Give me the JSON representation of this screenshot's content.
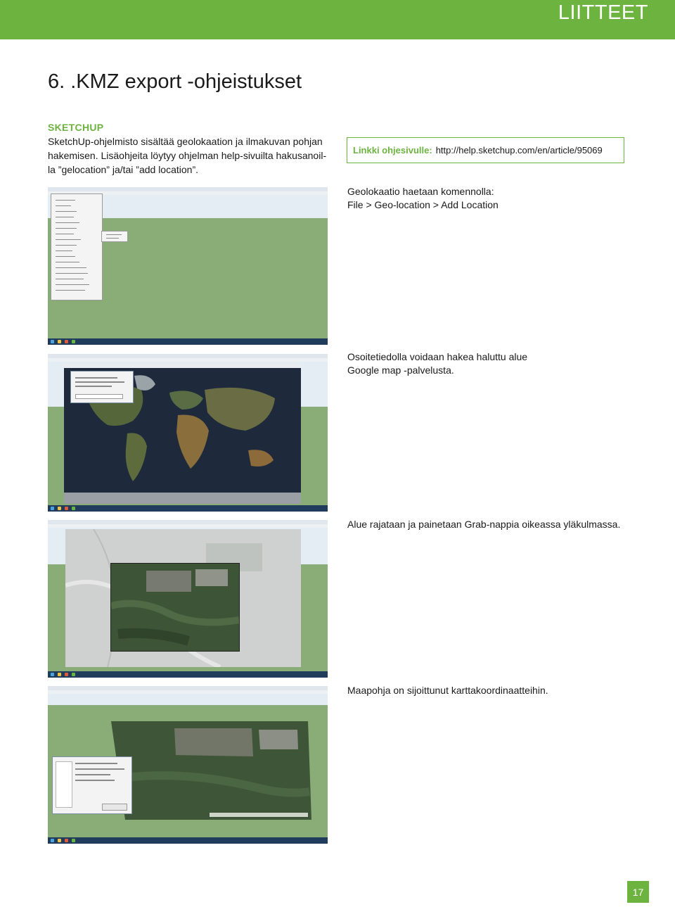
{
  "header": {
    "section_label": "LIITTEET"
  },
  "page": {
    "title": "6. .KMZ export -ohjeistukset",
    "section_heading": "SKETCHUP",
    "intro_lines": [
      "SketchUp-ohjelmisto sisältää geolokaation ja ilmakuvan pohjan",
      "hakemisen. Lisäohjeita löytyy ohjelman help-sivuilta hakusanoil-",
      "la ”gelocation” ja/tai ”add location”."
    ],
    "link_label": "Linkki ohjesivulle:",
    "link_url": "http://help.sketchup.com/en/article/95069",
    "steps": [
      {
        "lines": [
          "Geolokaatio haetaan komennolla:",
          "File > Geo-location > Add Location"
        ]
      },
      {
        "lines": [
          "Osoitetiedolla voidaan hakea haluttu alue",
          "Google map -palvelusta."
        ]
      },
      {
        "lines": [
          "Alue rajataan ja painetaan Grab-nappia oikeassa yläkulmassa."
        ]
      },
      {
        "lines": [
          "Maapohja on sijoittunut karttakoordinaatteihin."
        ]
      }
    ],
    "page_number": "17"
  },
  "colors": {
    "accent": "#6db33f",
    "text": "#1a1a1a"
  }
}
